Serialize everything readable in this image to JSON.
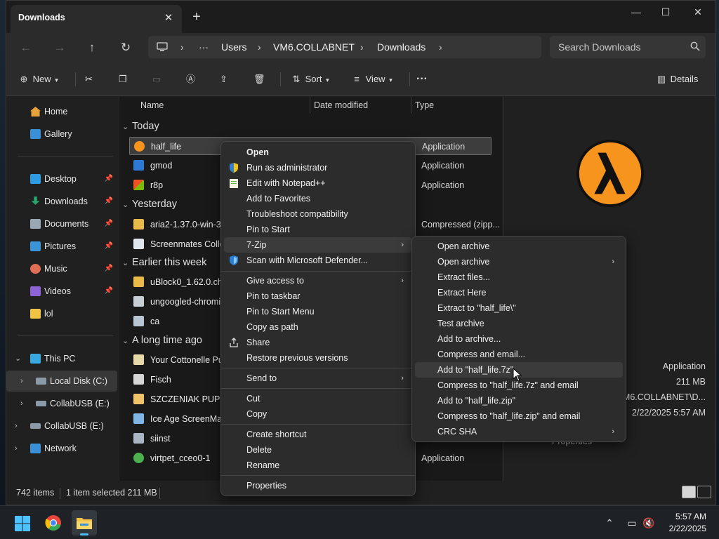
{
  "window": {
    "tab_title": "Downloads",
    "tab_close": "✕",
    "new_tab": "+",
    "minimize": "—",
    "maximize": "☐",
    "close": "✕"
  },
  "address": {
    "crumbs": [
      "Users",
      "VM6.COLLABNET",
      "Downloads"
    ],
    "ellipsis": "···",
    "search_placeholder": "Search Downloads"
  },
  "commandbar": {
    "new": "New",
    "sort": "Sort",
    "view": "View",
    "more": "···",
    "details": "Details"
  },
  "nav": {
    "home": "Home",
    "gallery": "Gallery",
    "desktop": "Desktop",
    "downloads": "Downloads",
    "documents": "Documents",
    "pictures": "Pictures",
    "music": "Music",
    "videos": "Videos",
    "lol": "lol",
    "this_pc": "This PC",
    "local_disk": "Local Disk (C:)",
    "collabusb_e1": "CollabUSB (E:)",
    "collabusb_e2": "CollabUSB (E:)",
    "network": "Network"
  },
  "columns": {
    "name": "Name",
    "date": "Date modified",
    "type": "Type"
  },
  "groups": {
    "today": "Today",
    "yesterday": "Yesterday",
    "earlier": "Earlier this week",
    "longago": "A long time ago"
  },
  "files": [
    {
      "name": "half_life",
      "type": "Application"
    },
    {
      "name": "gmod",
      "type": "Application"
    },
    {
      "name": "r8p",
      "type": "Application"
    },
    {
      "name": "aria2-1.37.0-win-32b",
      "type": "Compressed (zipp..."
    },
    {
      "name": "Screenmates Collect",
      "type": ""
    },
    {
      "name": "uBlock0_1.62.0.chron",
      "type": ""
    },
    {
      "name": "ungoogled-chromiu",
      "type": ""
    },
    {
      "name": "ca",
      "type": ""
    },
    {
      "name": "Your Cottonelle Pupp",
      "type": ""
    },
    {
      "name": "Fisch",
      "type": ""
    },
    {
      "name": "SZCZENIAK PUPPY",
      "type": ""
    },
    {
      "name": "Ice Age ScreenMate",
      "type": ""
    },
    {
      "name": "siinst",
      "type": ""
    },
    {
      "name": "virtpet_cceo0-1",
      "type": "Application"
    }
  ],
  "details": {
    "type": "Application",
    "size": "211 MB",
    "location": "M6.COLLABNET\\D...",
    "modified": "2/22/2025 5:57 AM",
    "properties": "Properties"
  },
  "status": {
    "count": "742 items",
    "selected": "1 item selected  211 MB"
  },
  "context_menu": [
    {
      "label": "Open",
      "bold": true
    },
    {
      "label": "Run as administrator",
      "icon": "shield-icon"
    },
    {
      "label": "Edit with Notepad++",
      "icon": "notepad-icon"
    },
    {
      "label": "Add to Favorites"
    },
    {
      "label": "Troubleshoot compatibility"
    },
    {
      "label": "Pin to Start"
    },
    {
      "label": "7-Zip",
      "submenu": true
    },
    {
      "label": "Scan with Microsoft Defender...",
      "icon": "defender-icon"
    },
    {
      "label": "Give access to",
      "submenu": true
    },
    {
      "label": "Pin to taskbar"
    },
    {
      "label": "Pin to Start Menu"
    },
    {
      "label": "Copy as path"
    },
    {
      "label": "Share",
      "icon": "share-icon"
    },
    {
      "label": "Restore previous versions"
    },
    {
      "label": "Send to",
      "submenu": true
    },
    {
      "label": "Cut"
    },
    {
      "label": "Copy"
    },
    {
      "label": "Create shortcut"
    },
    {
      "label": "Delete"
    },
    {
      "label": "Rename"
    },
    {
      "label": "Properties"
    }
  ],
  "submenu_7zip": [
    {
      "label": "Open archive"
    },
    {
      "label": "Open archive",
      "submenu": true
    },
    {
      "label": "Extract files..."
    },
    {
      "label": "Extract Here"
    },
    {
      "label": "Extract to \"half_life\\\""
    },
    {
      "label": "Test archive"
    },
    {
      "label": "Add to archive..."
    },
    {
      "label": "Compress and email..."
    },
    {
      "label": "Add to \"half_life.7z\""
    },
    {
      "label": "Compress to \"half_life.7z\" and email"
    },
    {
      "label": "Add to \"half_life.zip\""
    },
    {
      "label": "Compress to \"half_life.zip\" and email"
    },
    {
      "label": "CRC SHA",
      "submenu": true
    }
  ],
  "taskbar": {
    "time": "5:57 AM",
    "date": "2/22/2025"
  },
  "colors": {
    "accent": "#0078d4",
    "hl_orange": "#f7941d"
  }
}
